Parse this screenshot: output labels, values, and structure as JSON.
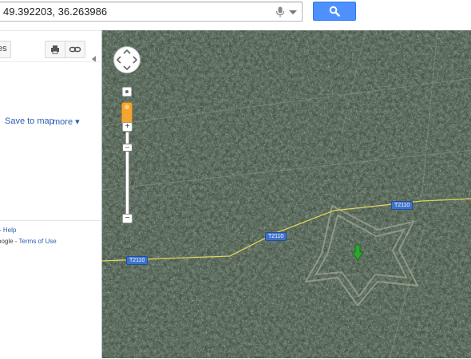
{
  "search": {
    "value": "49.392203, 36.263986"
  },
  "left_panel": {
    "directions_fragment": "es",
    "save_to_map": "Save to map",
    "more": "more ▾",
    "help_prefix": "- ",
    "help_link": "Help",
    "terms_prefix": "oogle - ",
    "terms_link": "Terms of Use"
  },
  "map": {
    "roads": [
      {
        "label": "T2110"
      },
      {
        "label": "T2110"
      },
      {
        "label": "T2110"
      }
    ],
    "zoom_in_label": "+",
    "zoom_out_label": "−",
    "marker_color": "#2fa52f"
  },
  "colors": {
    "search_button": "#4d90fe",
    "link": "#2a5db0",
    "road_line": "#e8d95a",
    "shield": "#3f72c9"
  }
}
